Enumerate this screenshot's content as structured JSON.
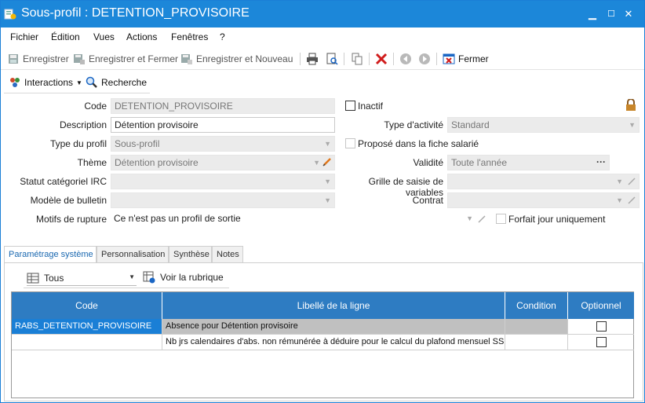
{
  "window": {
    "title": "Sous-profil : DETENTION_PROVISOIRE",
    "controls": {
      "minimize": "▁",
      "maximize": "☐",
      "close": "✕"
    }
  },
  "menu": [
    "Fichier",
    "Édition",
    "Vues",
    "Actions",
    "Fenêtres",
    "?"
  ],
  "toolbar": {
    "save": "Enregistrer",
    "save_close": "Enregistrer et Fermer",
    "save_new": "Enregistrer et Nouveau",
    "close": "Fermer"
  },
  "toolbar2": {
    "interactions": "Interactions",
    "search": "Recherche"
  },
  "form": {
    "code": {
      "label": "Code",
      "value": "DETENTION_PROVISOIRE"
    },
    "inactif": {
      "label": "Inactif",
      "checked": false
    },
    "description": {
      "label": "Description",
      "value": "Détention provisoire"
    },
    "type_activite": {
      "label": "Type d'activité",
      "value": "Standard"
    },
    "type_profil": {
      "label": "Type du profil",
      "value": "Sous-profil"
    },
    "propose": {
      "label": "Proposé dans la fiche salarié",
      "checked": false
    },
    "theme": {
      "label": "Thème",
      "value": "Détention provisoire"
    },
    "validite": {
      "label": "Validité",
      "value": "Toute l'année",
      "button": "···"
    },
    "statut_irc": {
      "label": "Statut catégoriel IRC",
      "value": ""
    },
    "grille": {
      "label": "Grille de saisie de variables",
      "value": ""
    },
    "modele": {
      "label": "Modèle de bulletin",
      "value": ""
    },
    "contrat": {
      "label": "Contrat",
      "value": ""
    },
    "motifs": {
      "label": "Motifs de rupture",
      "value": "Ce n'est pas un profil de sortie"
    },
    "forfait": {
      "label": "Forfait jour uniquement",
      "checked": false
    }
  },
  "tabs": [
    "Paramétrage système",
    "Personnalisation",
    "Synthèse",
    "Notes"
  ],
  "panel": {
    "filter": "Tous",
    "voir": "Voir la rubrique"
  },
  "grid": {
    "headers": [
      "Code",
      "Libellé de la ligne",
      "Condition",
      "Optionnel"
    ],
    "rows": [
      {
        "code": "RABS_DETENTION_PROVISOIRE",
        "libelle": "Absence pour Détention provisoire",
        "condition": "",
        "optionnel": false
      },
      {
        "code": "",
        "libelle": "Nb jrs calendaires d'abs. non rémunérée à déduire pour le calcul du plafond mensuel SS",
        "condition": "",
        "optionnel": false
      }
    ]
  },
  "colors": {
    "accent": "#1c87d9",
    "grid_header": "#2e7cc2",
    "selected": "#1a7fd6"
  }
}
